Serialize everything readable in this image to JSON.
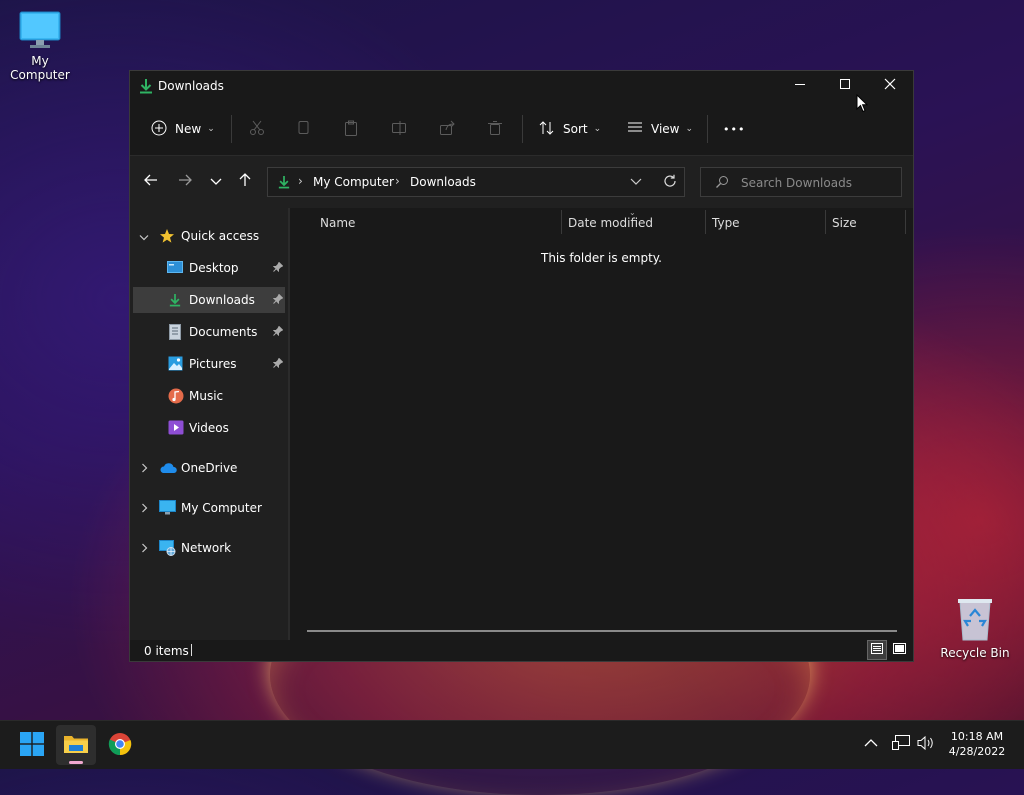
{
  "desktop": {
    "icons": [
      {
        "label": "My Computer",
        "icon": "monitor-icon"
      },
      {
        "label": "Recycle Bin",
        "icon": "recycle-bin-icon"
      }
    ]
  },
  "window": {
    "title": "Downloads",
    "controls": {
      "minimize": "minimize-icon",
      "maximize": "maximize-icon",
      "close": "close-icon"
    }
  },
  "toolbar": {
    "new_label": "New",
    "sort_label": "Sort",
    "view_label": "View",
    "more_label": "•••"
  },
  "address": {
    "crumbs": [
      "My Computer",
      "Downloads"
    ],
    "separator": "›"
  },
  "search": {
    "placeholder": "Search Downloads"
  },
  "sidebar": {
    "quick_access": "Quick access",
    "items": [
      {
        "label": "Desktop",
        "pinned": true
      },
      {
        "label": "Downloads",
        "pinned": true,
        "selected": true
      },
      {
        "label": "Documents",
        "pinned": true
      },
      {
        "label": "Pictures",
        "pinned": true
      },
      {
        "label": "Music",
        "pinned": false
      },
      {
        "label": "Videos",
        "pinned": false
      }
    ],
    "roots": [
      "OneDrive",
      "My Computer",
      "Network"
    ]
  },
  "columns": [
    "Name",
    "Date modified",
    "Type",
    "Size"
  ],
  "content": {
    "empty_text": "This folder is empty."
  },
  "status": {
    "items": "0 items"
  },
  "taskbar": {
    "time": "10:18 AM",
    "date": "4/28/2022"
  },
  "colors": {
    "accent": "#2fb463",
    "folder": "#f4c542",
    "selection": "#3d3d3d",
    "window_bg": "#191919"
  }
}
